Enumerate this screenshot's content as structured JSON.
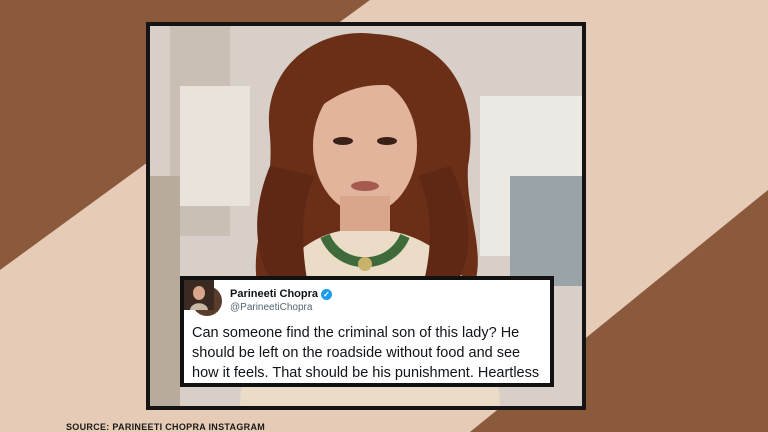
{
  "tweet": {
    "author_name": "Parineeti Chopra",
    "handle": "@ParineetiChopra",
    "text_lines": [
      "Can someone find the criminal son of this lady? He",
      "should be left on the roadside without food and see",
      "how it feels. That should be his punishment. Heartless"
    ],
    "verified_icon": "verified-badge-icon"
  },
  "caption": "SOURCE: PARINEETI CHOPRA INSTAGRAM",
  "colors": {
    "brown": "#8b5a3c",
    "beige": "#e6cbb6",
    "frame": "#141414",
    "verified_blue": "#1d9bf0"
  }
}
